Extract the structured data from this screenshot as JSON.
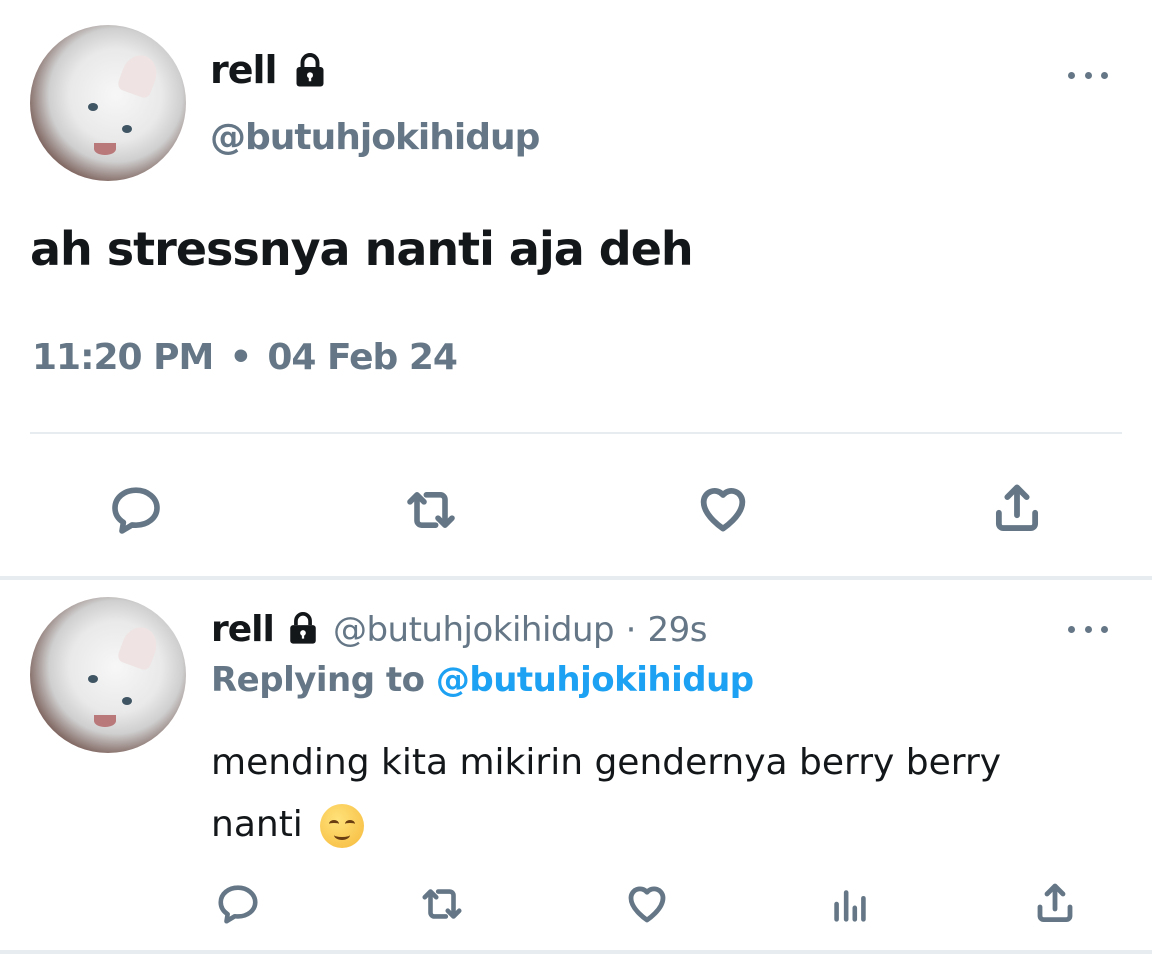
{
  "main_tweet": {
    "display_name": "rell",
    "handle": "@butuhjokihidup",
    "text": "ah stressnya nanti aja deh",
    "time": "11:20 PM",
    "separator": "•",
    "date": "04 Feb 24"
  },
  "reply_tweet": {
    "display_name": "rell",
    "handle": "@butuhjokihidup",
    "age_separator": "·",
    "age": "29s",
    "replying_label": "Replying to",
    "replying_handle": "@butuhjokihidup",
    "text": "mending kita mikirin gendernya berry berry nanti",
    "emoji_icon": "smiling-face-icon"
  },
  "icons": {
    "lock": "lock-icon",
    "more": "more-horizontal-icon",
    "reply": "speech-bubble-icon",
    "retweet": "retweet-icon",
    "like": "heart-icon",
    "share": "share-icon",
    "analytics": "bar-chart-icon"
  },
  "colors": {
    "text": "#14171a",
    "secondary": "#657786",
    "link": "#1da1f2",
    "divider": "#e6ecf0"
  }
}
